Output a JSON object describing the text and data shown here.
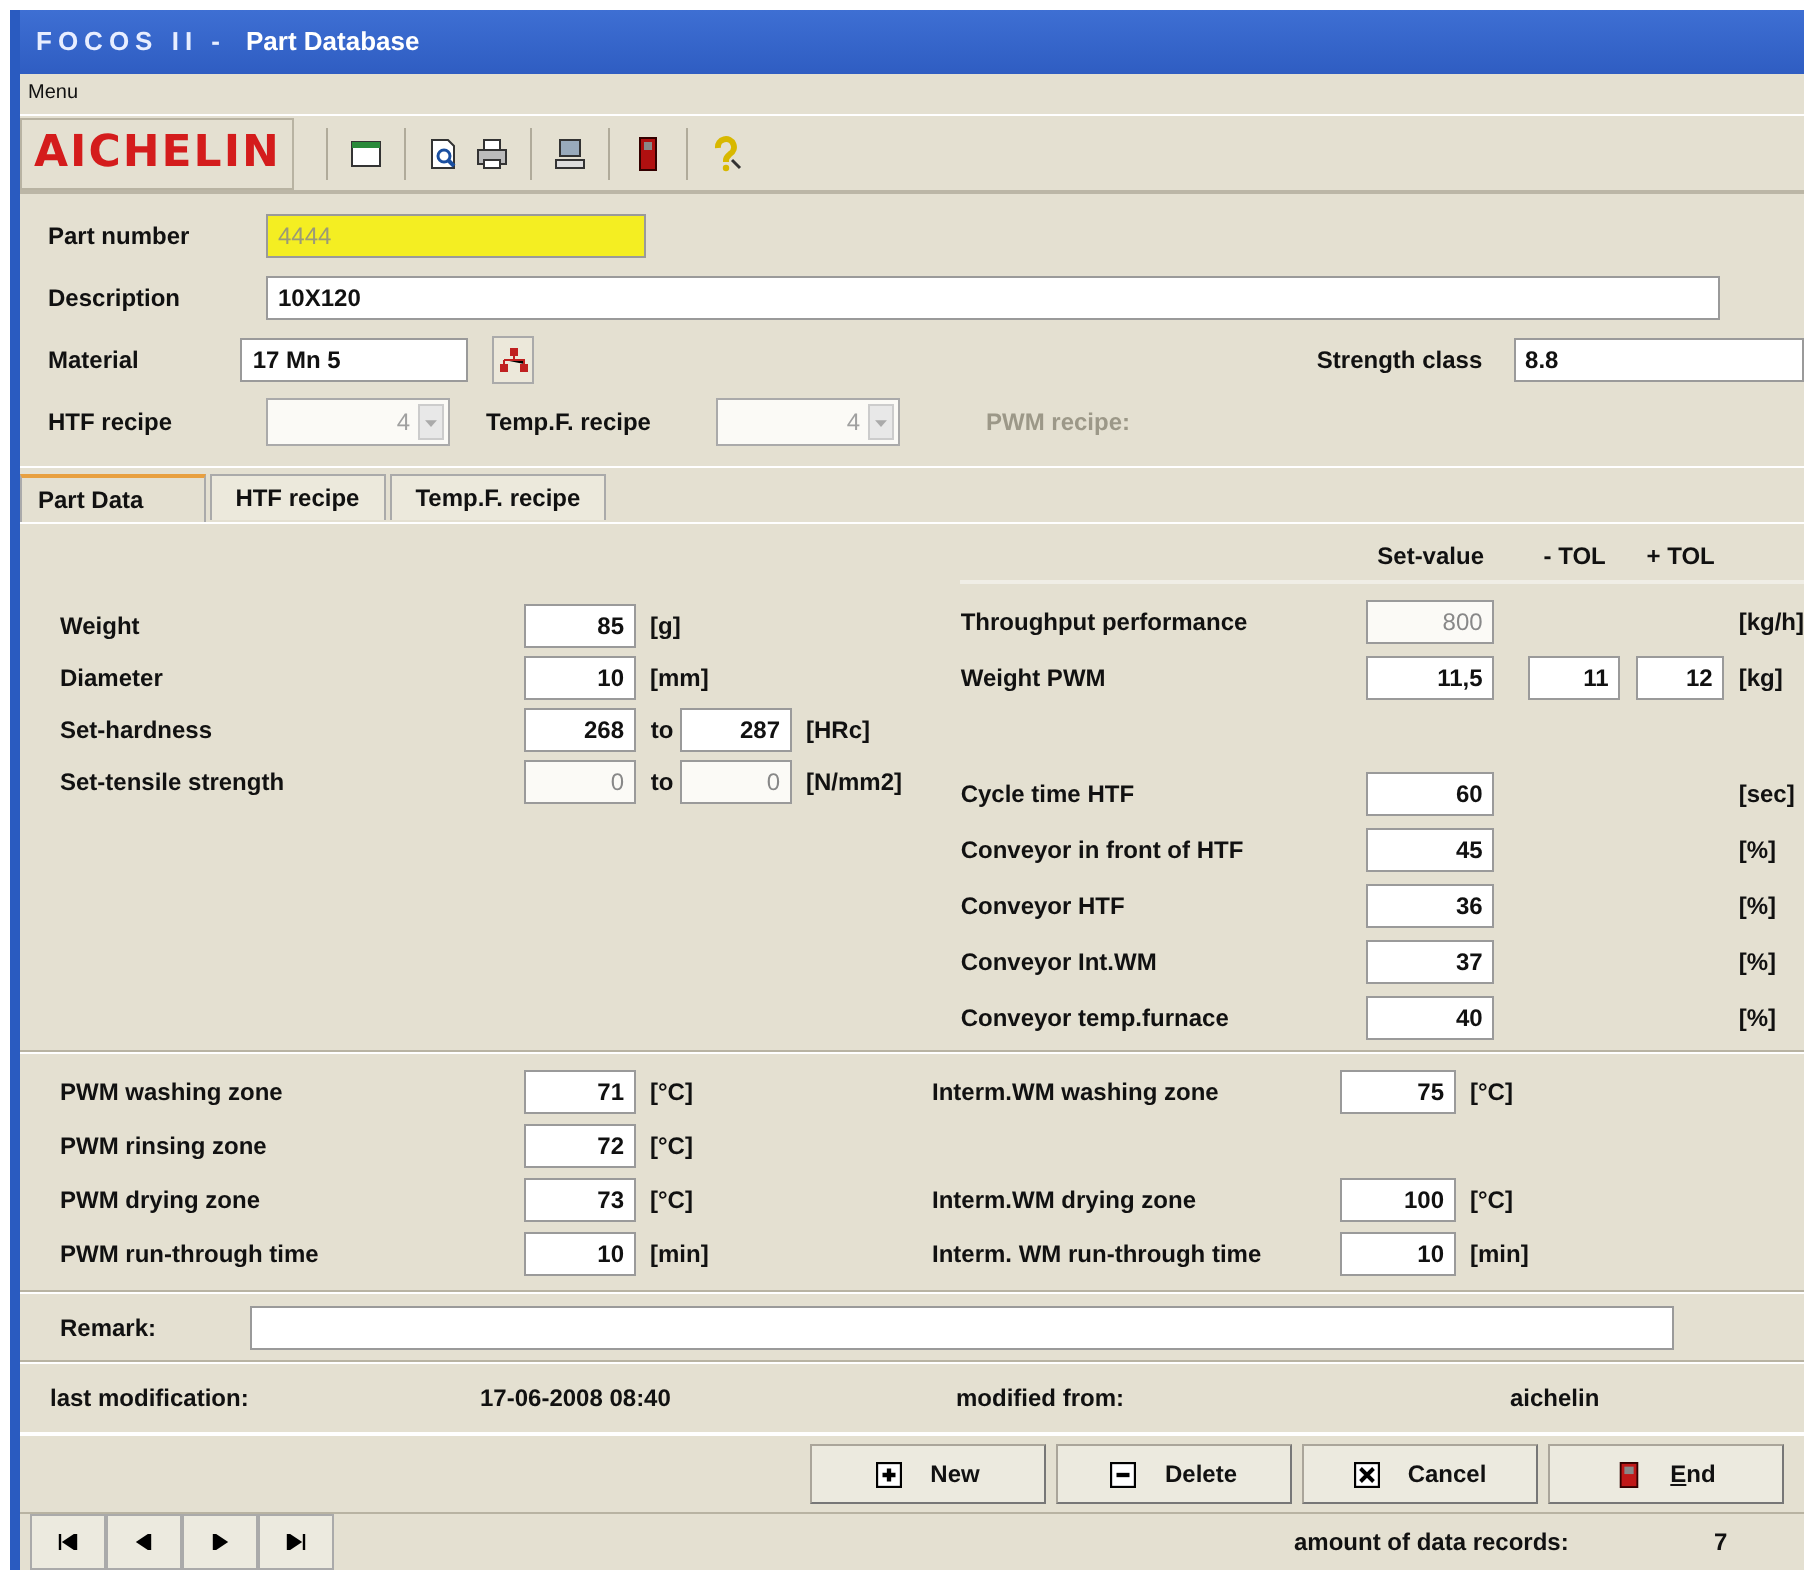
{
  "window": {
    "app": "FOCOS II -",
    "title": "Part Database"
  },
  "menu": [
    "Menu"
  ],
  "toolbar": {
    "logo": "AICHELIN"
  },
  "header": {
    "part_number": {
      "label": "Part number",
      "value": "4444",
      "highlighted": true
    },
    "description": {
      "label": "Description",
      "value": "10X120"
    },
    "material": {
      "label": "Material",
      "value": "17 Mn 5"
    },
    "strength_class": {
      "label": "Strength class",
      "value": "8.8"
    },
    "htf_recipe": {
      "label": "HTF recipe",
      "value": "4",
      "disabled": true
    },
    "temp_f_recipe": {
      "label": "Temp.F. recipe",
      "value": "4",
      "disabled": true
    },
    "pwm_recipe": {
      "label": "PWM recipe:",
      "disabled": true
    }
  },
  "tabs": [
    {
      "label": "Part Data",
      "selected": true
    },
    {
      "label": "HTF recipe",
      "selected": false
    },
    {
      "label": "Temp.F. recipe",
      "selected": false
    }
  ],
  "part_data": {
    "columns": [
      "Set-value",
      "- TOL",
      "+ TOL"
    ],
    "left_rows": [
      {
        "label": "Weight",
        "fields": [
          {
            "value": "85",
            "disabled": false
          }
        ],
        "unit": "[g]"
      },
      {
        "label": "Diameter",
        "fields": [
          {
            "value": "10",
            "disabled": false
          }
        ],
        "unit": "[mm]"
      },
      {
        "label": "Set-hardness",
        "fields": [
          {
            "value": "268",
            "disabled": false
          },
          {
            "value": "287",
            "disabled": false
          }
        ],
        "separator": "to",
        "unit": "[HRc]"
      },
      {
        "label": "Set-tensile strength",
        "fields": [
          {
            "value": "0",
            "disabled": true
          },
          {
            "value": "0",
            "disabled": true
          }
        ],
        "separator": "to",
        "unit": "[N/mm2]"
      }
    ],
    "right_groups": [
      [
        {
          "label": "Throughput performance",
          "set_value": {
            "value": "800",
            "disabled": true
          },
          "unit": "[kg/h]"
        },
        {
          "label": "Weight PWM",
          "set_value": {
            "value": "11,5",
            "disabled": false
          },
          "tol_minus": {
            "value": "11",
            "disabled": false
          },
          "tol_plus": {
            "value": "12",
            "disabled": false
          },
          "unit": "[kg]"
        }
      ],
      [
        {
          "label": "Cycle time HTF",
          "set_value": {
            "value": "60",
            "disabled": false
          },
          "unit": "[sec]"
        },
        {
          "label": "Conveyor in front of HTF",
          "set_value": {
            "value": "45",
            "disabled": false
          },
          "unit": "[%]"
        },
        {
          "label": "Conveyor HTF",
          "set_value": {
            "value": "36",
            "disabled": false
          },
          "unit": "[%]"
        },
        {
          "label": "Conveyor Int.WM",
          "set_value": {
            "value": "37",
            "disabled": false
          },
          "unit": "[%]"
        },
        {
          "label": "Conveyor temp.furnace",
          "set_value": {
            "value": "40",
            "disabled": false
          },
          "unit": "[%]"
        }
      ]
    ]
  },
  "zone_rows": [
    {
      "left": {
        "label": "PWM washing zone",
        "value": "71",
        "unit": "[°C]"
      },
      "right": {
        "label": "Interm.WM washing zone",
        "value": "75",
        "unit": "[°C]"
      }
    },
    {
      "left": {
        "label": "PWM rinsing zone",
        "value": "72",
        "unit": "[°C]"
      }
    },
    {
      "left": {
        "label": "PWM drying zone",
        "value": "73",
        "unit": "[°C]"
      },
      "right": {
        "label": "Interm.WM drying zone",
        "value": "100",
        "unit": "[°C]"
      }
    },
    {
      "left": {
        "label": "PWM run-through time",
        "value": "10",
        "unit": "[min]"
      },
      "right": {
        "label": "Interm. WM run-through time",
        "value": "10",
        "unit": "[min]"
      }
    }
  ],
  "remark": {
    "label": "Remark:"
  },
  "modification": {
    "last_label": "last modification:",
    "last_value": "17-06-2008 08:40",
    "by_label": "modified from:",
    "by_value": "aichelin"
  },
  "buttons": [
    {
      "label": "New",
      "kind": "new",
      "accelerator": false
    },
    {
      "label": "Delete",
      "kind": "delete",
      "accelerator": false
    },
    {
      "label": "Cancel",
      "kind": "cancel",
      "accelerator": false
    },
    {
      "label": "End",
      "kind": "end",
      "accelerator": true
    }
  ],
  "status": {
    "label": "amount of data records:",
    "value": "7"
  }
}
